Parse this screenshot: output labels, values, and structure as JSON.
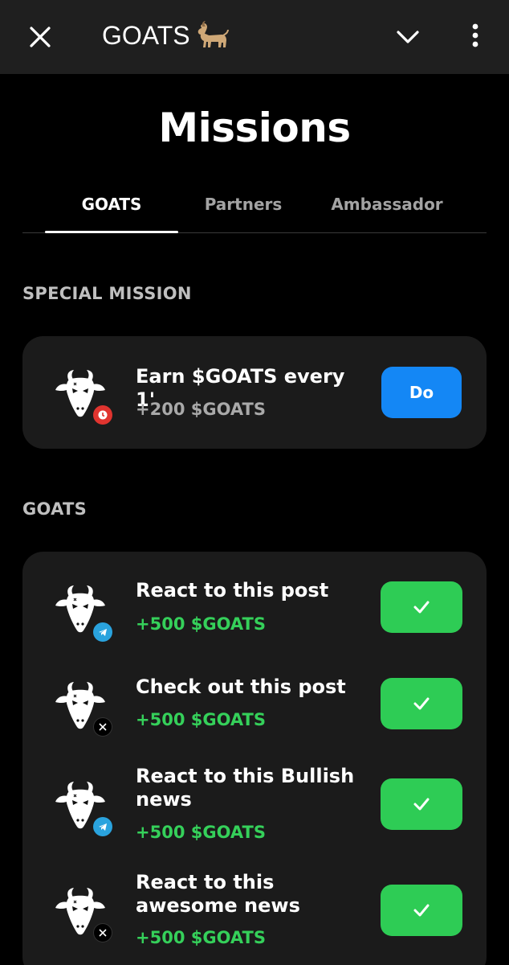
{
  "header": {
    "title": "GOATS",
    "emoji_icon": "goat-emoji-icon",
    "close_icon": "close-icon",
    "collapse_icon": "chevron-down-icon",
    "menu_icon": "more-vertical-icon"
  },
  "page": {
    "title": "Missions"
  },
  "tabs": [
    {
      "label": "GOATS",
      "active": true
    },
    {
      "label": "Partners",
      "active": false
    },
    {
      "label": "Ambassador",
      "active": false
    }
  ],
  "special_section": {
    "label": "SPECIAL MISSION",
    "mission": {
      "title": "Earn $GOATS every 1'",
      "reward": "+200 $GOATS",
      "badge": "clock-badge-icon",
      "action_label": "Do"
    }
  },
  "goats_section": {
    "label": "GOATS",
    "missions": [
      {
        "title": "React to this post",
        "reward": "+500 $GOATS",
        "badge": "telegram-icon",
        "status": "completed"
      },
      {
        "title": "Check out this post",
        "reward": "+500 $GOATS",
        "badge": "x-icon",
        "status": "completed"
      },
      {
        "title": "React to this Bullish news",
        "reward": "+500 $GOATS",
        "badge": "telegram-icon",
        "status": "completed"
      },
      {
        "title": "React to this awesome news",
        "reward": "+500 $GOATS",
        "badge": "x-icon",
        "status": "completed"
      }
    ]
  },
  "colors": {
    "background": "#000000",
    "topbar": "#1f1f1f",
    "card": "#1b1b1b",
    "do_button": "#1487f5",
    "done_button": "#2ecc55",
    "reward_green": "#35d05a",
    "telegram": "#2aa3de",
    "clock_badge": "#e0342f"
  }
}
